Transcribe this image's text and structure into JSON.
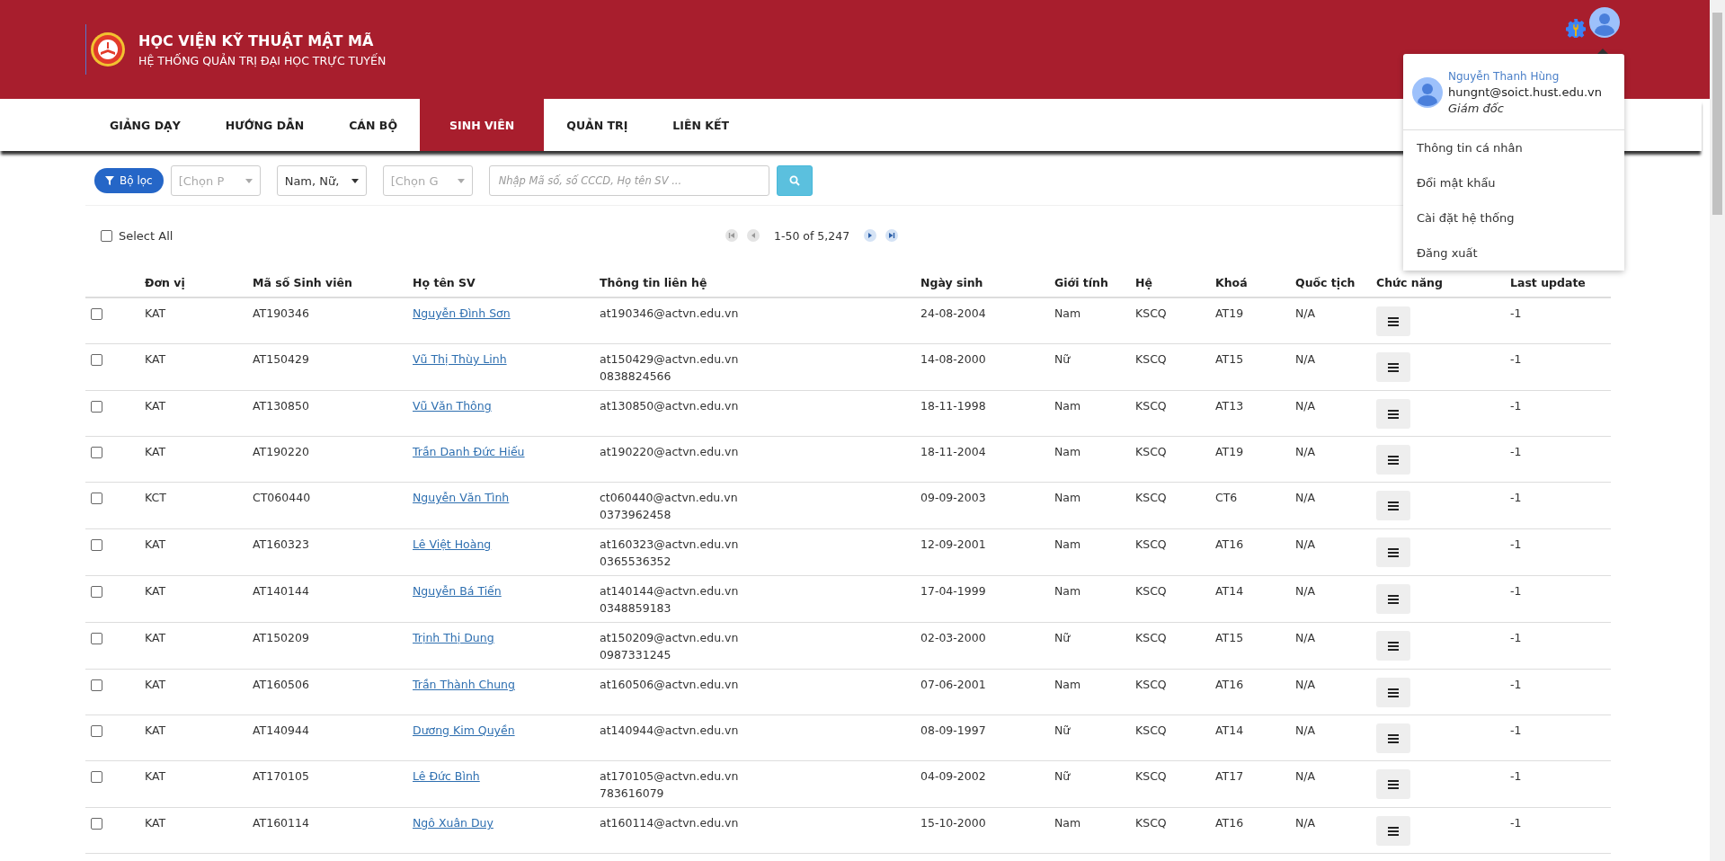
{
  "header": {
    "title": "HỌC VIỆN KỸ THUẬT MẬT MÃ",
    "subtitle": "HỆ THỐNG QUẢN TRỊ ĐẠI HỌC TRỰC TUYẾN"
  },
  "nav": [
    {
      "label": "GIẢNG DẠY",
      "selected": false
    },
    {
      "label": "HƯỚNG DẪN",
      "selected": false
    },
    {
      "label": "CÁN BỘ",
      "selected": false
    },
    {
      "label": "SINH VIÊN",
      "selected": true
    },
    {
      "label": "QUẢN TRỊ",
      "selected": false
    },
    {
      "label": "LIÊN KẾT",
      "selected": false
    }
  ],
  "filters": {
    "filter_button": "Bộ lọc",
    "selects": [
      {
        "placeholder": "[Chọn P"
      },
      {
        "value": "Nam, Nữ,"
      },
      {
        "placeholder": "[Chọn G"
      }
    ],
    "search": {
      "placeholder": "Nhập Mã số, số CCCD, Họ tên SV ..."
    }
  },
  "toolbar": {
    "select_all": {
      "label": "Select All",
      "checked": false
    },
    "pagination": "1-50 of 5,247"
  },
  "table": {
    "columns": [
      "Đơn vị",
      "Mã số Sinh viên",
      "Họ tên SV",
      "Thông tin liên hệ",
      "Ngày sinh",
      "Giới tính",
      "Hệ",
      "Khoá",
      "Quốc tịch",
      "Chức năng",
      "Last update"
    ],
    "rows": [
      {
        "checked": false,
        "unit": "KAT",
        "id": "AT190346",
        "name": "Nguyễn Đình Sơn",
        "email": "at190346@actvn.edu.vn",
        "dob": "24-08-2004",
        "gender": "Nam",
        "system": "KSCQ",
        "cohort": "AT19",
        "nationality": "N/A",
        "last_update": "-1"
      },
      {
        "checked": false,
        "unit": "KAT",
        "id": "AT150429",
        "name": "Vũ Thị Thùy Linh",
        "email": "at150429@actvn.edu.vn",
        "phone": "0838824566",
        "dob": "14-08-2000",
        "gender": "Nữ",
        "system": "KSCQ",
        "cohort": "AT15",
        "nationality": "N/A",
        "last_update": "-1"
      },
      {
        "checked": false,
        "unit": "KAT",
        "id": "AT130850",
        "name": "Vũ Văn Thông",
        "email": "at130850@actvn.edu.vn",
        "dob": "18-11-1998",
        "gender": "Nam",
        "system": "KSCQ",
        "cohort": "AT13",
        "nationality": "N/A",
        "last_update": "-1"
      },
      {
        "checked": false,
        "unit": "KAT",
        "id": "AT190220",
        "name": "Trần Danh Đức Hiếu",
        "email": "at190220@actvn.edu.vn",
        "dob": "18-11-2004",
        "gender": "Nam",
        "system": "KSCQ",
        "cohort": "AT19",
        "nationality": "N/A",
        "last_update": "-1"
      },
      {
        "checked": false,
        "unit": "KCT",
        "id": "CT060440",
        "name": "Nguyễn Văn Tình",
        "email": "ct060440@actvn.edu.vn",
        "phone": "0373962458",
        "dob": "09-09-2003",
        "gender": "Nam",
        "system": "KSCQ",
        "cohort": "CT6",
        "nationality": "N/A",
        "last_update": "-1"
      },
      {
        "checked": false,
        "unit": "KAT",
        "id": "AT160323",
        "name": "Lê Việt Hoàng",
        "email": "at160323@actvn.edu.vn",
        "phone": "0365536352",
        "dob": "12-09-2001",
        "gender": "Nam",
        "system": "KSCQ",
        "cohort": "AT16",
        "nationality": "N/A",
        "last_update": "-1"
      },
      {
        "checked": false,
        "unit": "KAT",
        "id": "AT140144",
        "name": "Nguyễn Bá Tiến",
        "email": "at140144@actvn.edu.vn",
        "phone": "0348859183",
        "dob": "17-04-1999",
        "gender": "Nam",
        "system": "KSCQ",
        "cohort": "AT14",
        "nationality": "N/A",
        "last_update": "-1"
      },
      {
        "checked": false,
        "unit": "KAT",
        "id": "AT150209",
        "name": "Trịnh Thị Dung",
        "email": "at150209@actvn.edu.vn",
        "phone": "0987331245",
        "dob": "02-03-2000",
        "gender": "Nữ",
        "system": "KSCQ",
        "cohort": "AT15",
        "nationality": "N/A",
        "last_update": "-1"
      },
      {
        "checked": false,
        "unit": "KAT",
        "id": "AT160506",
        "name": "Trần Thành Chung",
        "email": "at160506@actvn.edu.vn",
        "dob": "07-06-2001",
        "gender": "Nam",
        "system": "KSCQ",
        "cohort": "AT16",
        "nationality": "N/A",
        "last_update": "-1"
      },
      {
        "checked": false,
        "unit": "KAT",
        "id": "AT140944",
        "name": "Dương Kim Quyền",
        "email": "at140944@actvn.edu.vn",
        "dob": "08-09-1997",
        "gender": "Nữ",
        "system": "KSCQ",
        "cohort": "AT14",
        "nationality": "N/A",
        "last_update": "-1"
      },
      {
        "checked": false,
        "unit": "KAT",
        "id": "AT170105",
        "name": "Lê Đức Bình",
        "email": "at170105@actvn.edu.vn",
        "phone": "783616079",
        "dob": "04-09-2002",
        "gender": "Nữ",
        "system": "KSCQ",
        "cohort": "AT17",
        "nationality": "N/A",
        "last_update": "-1"
      },
      {
        "checked": false,
        "unit": "KAT",
        "id": "AT160114",
        "name": "Ngô Xuân Duy",
        "email": "at160114@actvn.edu.vn",
        "dob": "15-10-2000",
        "gender": "Nam",
        "system": "KSCQ",
        "cohort": "AT16",
        "nationality": "N/A",
        "last_update": "-1"
      }
    ]
  },
  "user_menu": {
    "name": "Nguyễn Thanh Hùng",
    "email": "hungnt@soict.hust.edu.vn",
    "role": "Giám đốc",
    "items": [
      "Thông tin cá nhân",
      "Đổi mật khẩu",
      "Cài đặt hệ thống",
      "Đăng xuất"
    ]
  }
}
